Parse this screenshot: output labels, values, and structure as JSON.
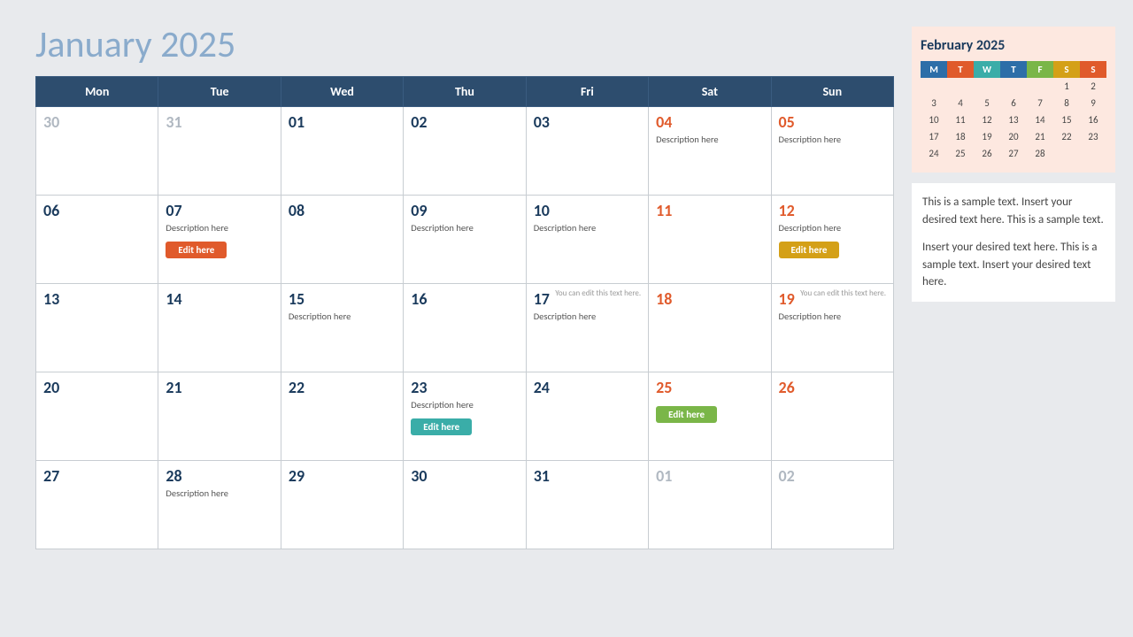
{
  "header": {
    "title_bold": "January",
    "title_light": "2025"
  },
  "weekdays": [
    "Mon",
    "Tue",
    "Wed",
    "Thu",
    "Fri",
    "Sat",
    "Sun"
  ],
  "rows": [
    [
      {
        "num": "30",
        "type": "other-month",
        "desc": "",
        "smallText": "",
        "btn": null
      },
      {
        "num": "31",
        "type": "other-month",
        "desc": "",
        "smallText": "",
        "btn": null
      },
      {
        "num": "01",
        "type": "normal",
        "desc": "",
        "smallText": "",
        "btn": null
      },
      {
        "num": "02",
        "type": "normal",
        "desc": "",
        "smallText": "",
        "btn": null
      },
      {
        "num": "03",
        "type": "normal",
        "desc": "",
        "smallText": "",
        "btn": null
      },
      {
        "num": "04",
        "type": "weekend",
        "desc": "Description here",
        "smallText": "",
        "btn": null
      },
      {
        "num": "05",
        "type": "weekend",
        "desc": "Description here",
        "smallText": "",
        "btn": null
      }
    ],
    [
      {
        "num": "06",
        "type": "normal",
        "desc": "",
        "smallText": "",
        "btn": null
      },
      {
        "num": "07",
        "type": "normal",
        "desc": "Description here",
        "smallText": "",
        "btn": {
          "label": "Edit here",
          "color": "orange"
        }
      },
      {
        "num": "08",
        "type": "normal",
        "desc": "",
        "smallText": "",
        "btn": null
      },
      {
        "num": "09",
        "type": "normal",
        "desc": "Description here",
        "smallText": "",
        "btn": null
      },
      {
        "num": "10",
        "type": "normal",
        "desc": "Description here",
        "smallText": "",
        "btn": null
      },
      {
        "num": "11",
        "type": "weekend",
        "desc": "",
        "smallText": "",
        "btn": null
      },
      {
        "num": "12",
        "type": "weekend",
        "desc": "Description here",
        "smallText": "",
        "btn": {
          "label": "Edit here",
          "color": "yellow"
        }
      }
    ],
    [
      {
        "num": "13",
        "type": "normal",
        "desc": "",
        "smallText": "",
        "btn": null
      },
      {
        "num": "14",
        "type": "normal",
        "desc": "",
        "smallText": "",
        "btn": null
      },
      {
        "num": "15",
        "type": "normal",
        "desc": "Description here",
        "smallText": "",
        "btn": null
      },
      {
        "num": "16",
        "type": "normal",
        "desc": "",
        "smallText": "",
        "btn": null
      },
      {
        "num": "17",
        "type": "normal",
        "desc": "Description here",
        "smallText": "You can edit this text here.",
        "btn": null
      },
      {
        "num": "18",
        "type": "weekend",
        "desc": "",
        "smallText": "",
        "btn": null
      },
      {
        "num": "19",
        "type": "weekend",
        "desc": "Description here",
        "smallText": "You can edit this text here.",
        "btn": null
      }
    ],
    [
      {
        "num": "20",
        "type": "normal",
        "desc": "",
        "smallText": "",
        "btn": null
      },
      {
        "num": "21",
        "type": "normal",
        "desc": "",
        "smallText": "",
        "btn": null
      },
      {
        "num": "22",
        "type": "normal",
        "desc": "",
        "smallText": "",
        "btn": null
      },
      {
        "num": "23",
        "type": "normal",
        "desc": "Description here",
        "smallText": "",
        "btn": {
          "label": "Edit here",
          "color": "teal"
        }
      },
      {
        "num": "24",
        "type": "normal",
        "desc": "",
        "smallText": "",
        "btn": null
      },
      {
        "num": "25",
        "type": "weekend",
        "desc": "",
        "smallText": "",
        "btn": {
          "label": "Edit here",
          "color": "green"
        }
      },
      {
        "num": "26",
        "type": "weekend",
        "desc": "",
        "smallText": "",
        "btn": null
      }
    ],
    [
      {
        "num": "27",
        "type": "normal",
        "desc": "",
        "smallText": "",
        "btn": null
      },
      {
        "num": "28",
        "type": "normal",
        "desc": "Description here",
        "smallText": "",
        "btn": null
      },
      {
        "num": "29",
        "type": "normal",
        "desc": "",
        "smallText": "",
        "btn": null
      },
      {
        "num": "30",
        "type": "normal",
        "desc": "",
        "smallText": "",
        "btn": null
      },
      {
        "num": "31",
        "type": "normal",
        "desc": "",
        "smallText": "",
        "btn": null
      },
      {
        "num": "01",
        "type": "other-month",
        "desc": "",
        "smallText": "",
        "btn": null
      },
      {
        "num": "02",
        "type": "other-month",
        "desc": "",
        "smallText": "",
        "btn": null
      }
    ]
  ],
  "mini": {
    "title": "February 2025",
    "headers": [
      "M",
      "T",
      "W",
      "T",
      "F",
      "S",
      "S"
    ],
    "header_classes": [
      "m",
      "t",
      "w",
      "th",
      "f",
      "s",
      "su"
    ],
    "rows": [
      [
        "",
        "",
        "",
        "",
        "",
        "1",
        "2"
      ],
      [
        "3",
        "4",
        "5",
        "6",
        "7",
        "8",
        "9"
      ],
      [
        "10",
        "11",
        "12",
        "13",
        "14",
        "15",
        "16"
      ],
      [
        "17",
        "18",
        "19",
        "20",
        "21",
        "22",
        "23"
      ],
      [
        "24",
        "25",
        "26",
        "27",
        "28",
        "",
        ""
      ]
    ]
  },
  "sidebar": {
    "text1": "This is a sample text. Insert your desired text here. This is a sample text.",
    "text2": "Insert your desired text here. This is a sample text. Insert your desired text here."
  }
}
